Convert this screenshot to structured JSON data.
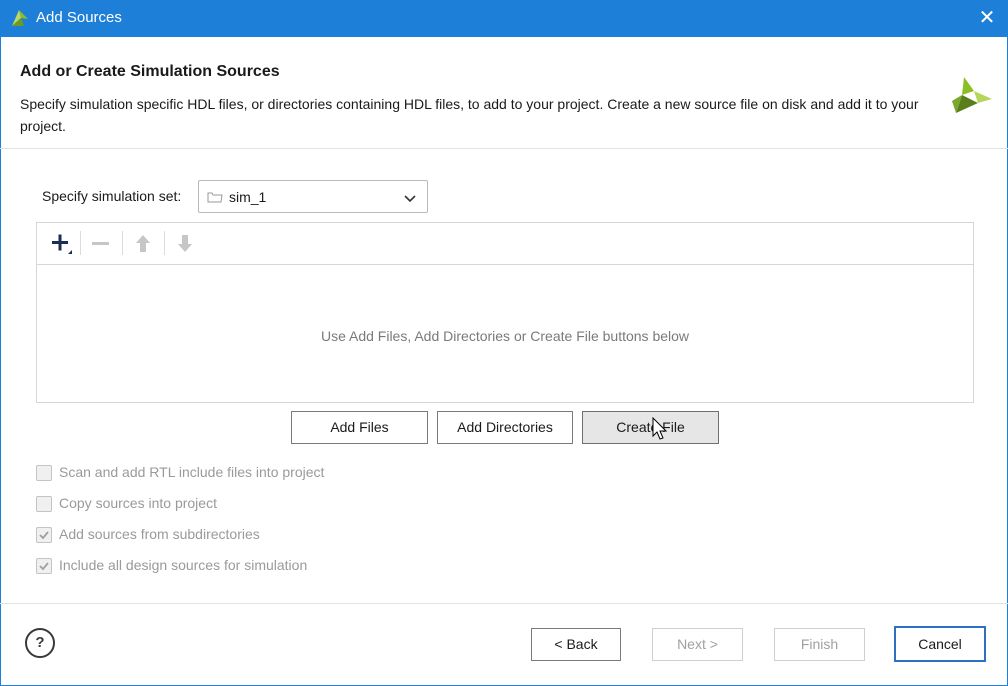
{
  "window": {
    "title": "Add Sources",
    "close_label": "✕"
  },
  "header": {
    "heading": "Add or Create Simulation Sources",
    "description": "Specify simulation specific HDL files, or directories containing HDL files, to add to your project. Create a new source file on disk and add it to your project."
  },
  "simulation_set": {
    "label": "Specify simulation set:",
    "value": "sim_1"
  },
  "file_list": {
    "empty_message": "Use Add Files, Add Directories or Create File buttons below"
  },
  "buttons": {
    "add_files": "Add Files",
    "add_directories": "Add Directories",
    "create_file": "Create File"
  },
  "options": [
    {
      "label": "Scan and add RTL include files into project",
      "checked": false
    },
    {
      "label": "Copy sources into project",
      "checked": false
    },
    {
      "label": "Add sources from subdirectories",
      "checked": true
    },
    {
      "label": "Include all design sources for simulation",
      "checked": true
    }
  ],
  "footer": {
    "help": "?",
    "back": "< Back",
    "next": "Next >",
    "finish": "Finish",
    "cancel": "Cancel"
  },
  "colors": {
    "titlebar": "#1d7fd8",
    "logo_green": "#8cbf26",
    "logo_dark": "#5a7f1a"
  }
}
